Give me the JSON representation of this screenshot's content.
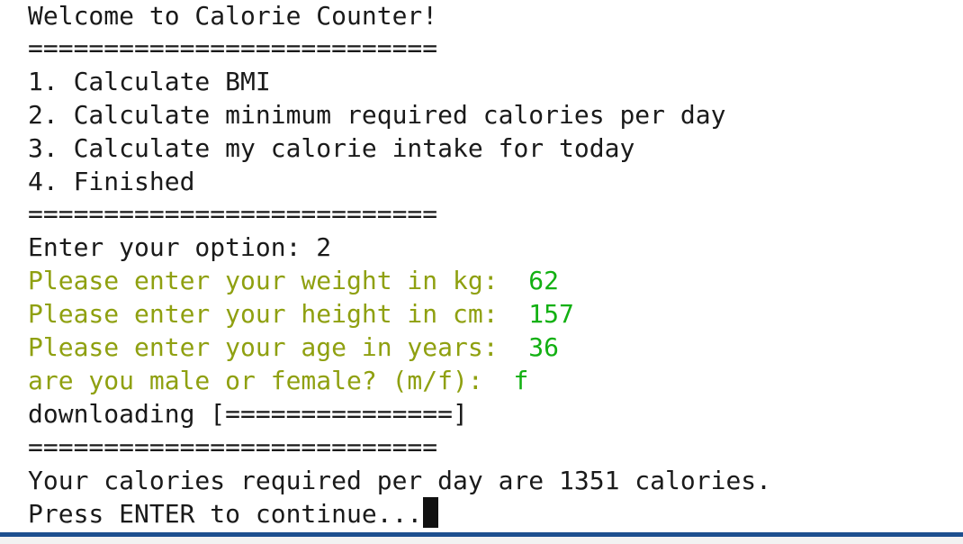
{
  "terminal": {
    "welcome": "Welcome to Calorie Counter!",
    "separator": "===========================",
    "menu": [
      "1. Calculate BMI",
      "2. Calculate minimum required calories per day",
      "3. Calculate my calorie intake for today",
      "4. Finished"
    ],
    "option_prompt": "Enter your option: ",
    "option_value": "2",
    "questions": [
      {
        "prompt": "Please enter your weight in kg:  ",
        "answer": "62"
      },
      {
        "prompt": "Please enter your height in cm:  ",
        "answer": "157"
      },
      {
        "prompt": "Please enter your age in years:  ",
        "answer": "36"
      },
      {
        "prompt": "are you male or female? (m/f):  ",
        "answer": "f"
      }
    ],
    "downloading": "downloading [===============]",
    "result": "Your calories required per day are 1351 calories.",
    "continue_prompt": "Press ENTER to continue..."
  },
  "colors": {
    "prompt": "#8fa010",
    "answer": "#12b012",
    "bottom_bar": "#1d4f8f"
  }
}
